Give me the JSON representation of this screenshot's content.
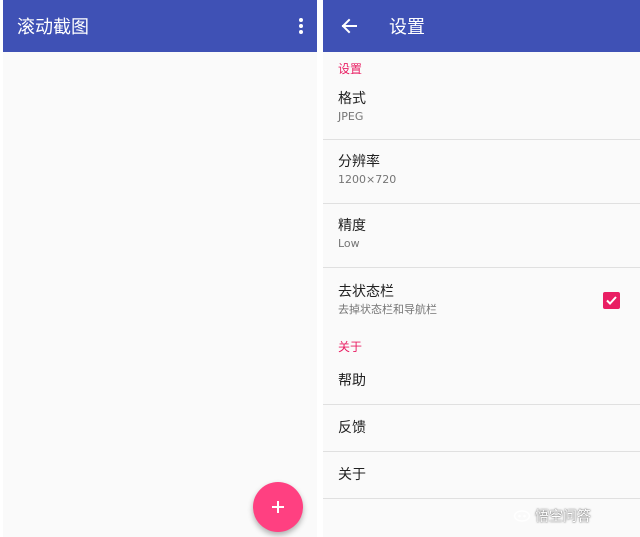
{
  "colors": {
    "primary": "#3f51b5",
    "accent": "#ff4081",
    "category": "#e91e63",
    "background": "#fafafa"
  },
  "left": {
    "title": "滚动截图",
    "overflow_icon": "more-vert-icon",
    "fab_icon": "plus-icon"
  },
  "right": {
    "title": "设置",
    "back_icon": "arrow-back-icon",
    "categories": [
      {
        "title": "设置",
        "items": [
          {
            "label": "格式",
            "summary": "JPEG"
          },
          {
            "label": "分辨率",
            "summary": "1200×720"
          },
          {
            "label": "精度",
            "summary": "Low"
          },
          {
            "label": "去状态栏",
            "summary": "去掉状态栏和导航栏",
            "checked": true
          }
        ]
      },
      {
        "title": "关于",
        "items": [
          {
            "label": "帮助"
          },
          {
            "label": "反馈"
          },
          {
            "label": "关于"
          }
        ]
      }
    ]
  },
  "watermark": {
    "text": "悟空问答"
  }
}
